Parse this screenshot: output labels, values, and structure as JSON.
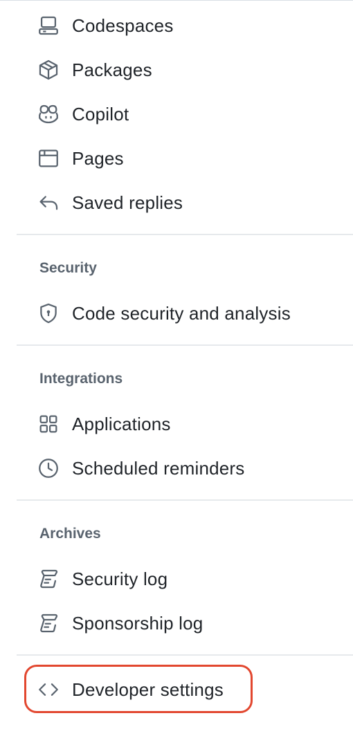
{
  "account_nav": {
    "items_top": [
      {
        "label": "Codespaces",
        "icon": "codespaces-icon"
      },
      {
        "label": "Packages",
        "icon": "package-icon"
      },
      {
        "label": "Copilot",
        "icon": "copilot-icon"
      },
      {
        "label": "Pages",
        "icon": "browser-window-icon"
      },
      {
        "label": "Saved replies",
        "icon": "reply-icon"
      }
    ],
    "security": {
      "heading": "Security",
      "items": [
        {
          "label": "Code security and analysis",
          "icon": "shield-lock-icon"
        }
      ]
    },
    "integrations": {
      "heading": "Integrations",
      "items": [
        {
          "label": "Applications",
          "icon": "apps-icon"
        },
        {
          "label": "Scheduled reminders",
          "icon": "clock-icon"
        }
      ]
    },
    "archives": {
      "heading": "Archives",
      "items": [
        {
          "label": "Security log",
          "icon": "log-icon"
        },
        {
          "label": "Sponsorship log",
          "icon": "log-icon"
        }
      ]
    },
    "developer_settings": {
      "label": "Developer settings",
      "icon": "code-icon"
    }
  },
  "colors": {
    "text": "#1f2328",
    "muted": "#59636e",
    "divider": "#e6e9ec",
    "highlight": "#e2472f"
  }
}
